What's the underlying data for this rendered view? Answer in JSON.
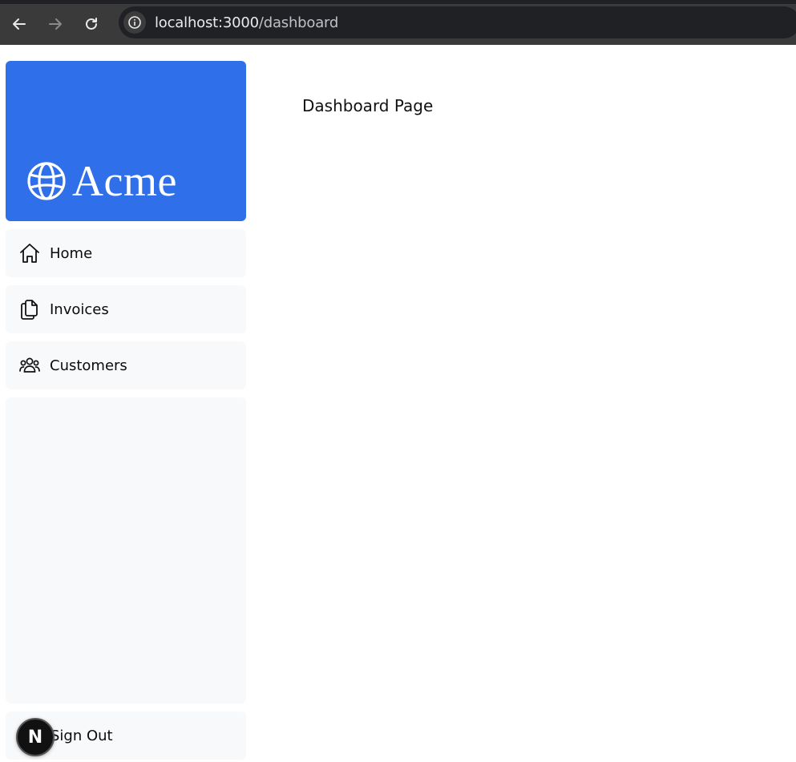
{
  "browser": {
    "url_host": "localhost:3000",
    "url_path": "/dashboard"
  },
  "brand": {
    "name": "Acme",
    "color": "#2f6fe9"
  },
  "sidebar": {
    "items": [
      {
        "label": "Home",
        "icon": "home-icon"
      },
      {
        "label": "Invoices",
        "icon": "document-duplicate-icon"
      },
      {
        "label": "Customers",
        "icon": "user-group-icon"
      }
    ],
    "sign_out_label": "Sign Out",
    "background": "#f8f9fb"
  },
  "dev_badge": {
    "letter": "N"
  },
  "main": {
    "title": "Dashboard Page"
  }
}
